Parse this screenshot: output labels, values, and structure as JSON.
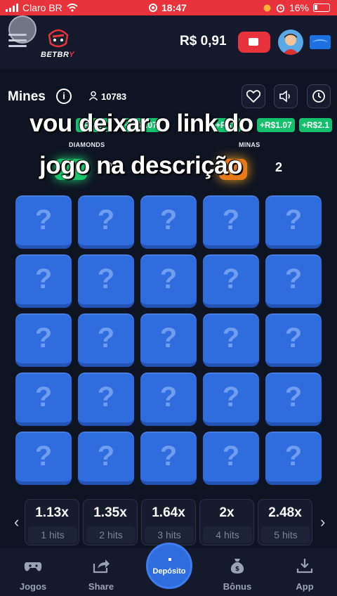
{
  "status_bar": {
    "carrier": "Claro BR",
    "time": "18:47",
    "battery": "16%"
  },
  "header": {
    "logo_text": "BETBRY",
    "balance": "R$ 0,91"
  },
  "game": {
    "title": "Mines",
    "players": "10783"
  },
  "ticker": [
    "+R$1.0",
    "+R$1.07",
    "+R$1.",
    "+R$1.07",
    "+R$2.1"
  ],
  "overlay": {
    "line1": "vou deixar o link do",
    "line2": "jogo na descrição"
  },
  "stats": {
    "diamonds_label": "DIAMONDS",
    "diamonds_value": "2",
    "mines_label": "MINAS",
    "mines_value": "2"
  },
  "tiles": [
    "?",
    "?",
    "?",
    "?",
    "?",
    "?",
    "?",
    "?",
    "?",
    "?",
    "?",
    "?",
    "?",
    "?",
    "?",
    "?",
    "?",
    "?",
    "?",
    "?",
    "?",
    "?",
    "?",
    "?",
    "?"
  ],
  "multipliers": [
    {
      "value": "1.13x",
      "hits": "1 hits"
    },
    {
      "value": "1.35x",
      "hits": "2 hits"
    },
    {
      "value": "1.64x",
      "hits": "3 hits"
    },
    {
      "value": "2x",
      "hits": "4 hits"
    },
    {
      "value": "2.48x",
      "hits": "5 hits"
    }
  ],
  "nav": {
    "games": "Jogos",
    "share": "Share",
    "deposit": "Depósito",
    "bonus": "Bônus",
    "app": "App"
  },
  "colors": {
    "status_bar": "#e8323c",
    "tile": "#2f6cde",
    "ticker_green": "#14c06b"
  }
}
